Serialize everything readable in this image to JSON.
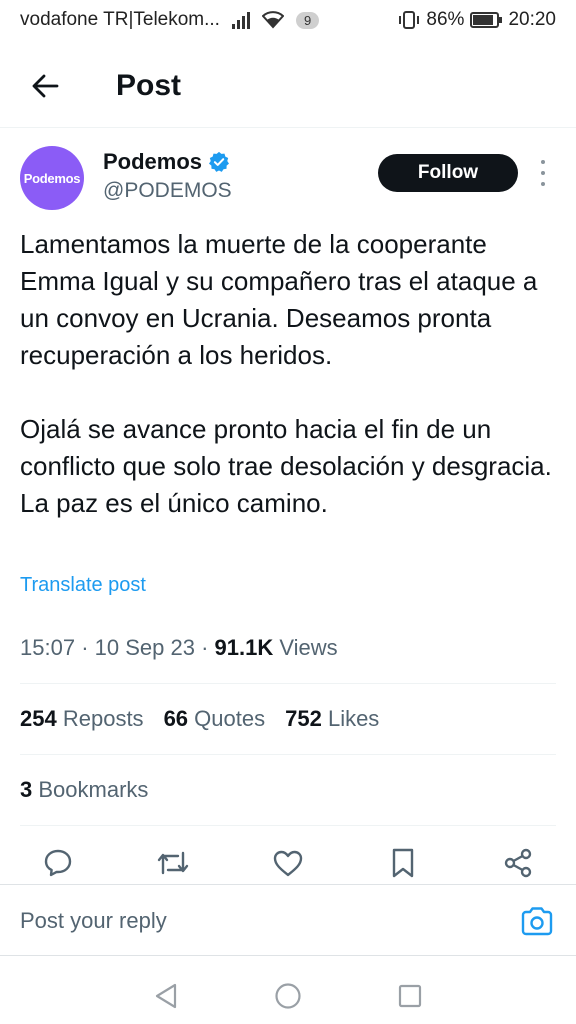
{
  "status_bar": {
    "carrier": "vodafone TR|Telekom...",
    "notification_count": "9",
    "battery": "86%",
    "time": "20:20"
  },
  "header": {
    "title": "Post",
    "back_icon": "arrow-left-icon"
  },
  "author": {
    "avatar_text": "Podemos",
    "name": "Podemos",
    "handle": "@PODEMOS",
    "verified": true,
    "follow_label": "Follow"
  },
  "post": {
    "paragraph_1": "Lamentamos la muerte de la cooperante Emma Igual y su compañero tras el ataque a un convoy en Ucrania. Deseamos pronta recuperación a los heridos.",
    "paragraph_2": "Ojalá se avance pronto hacia el fin de un conflicto que solo trae desolación y desgracia. La paz es el único camino.",
    "translate_label": "Translate post",
    "time": "15:07",
    "date": "10 Sep 23",
    "views_count": "91.1K",
    "views_label": "Views",
    "separator": "·"
  },
  "stats": {
    "reposts_count": "254",
    "reposts_label": "Reposts",
    "quotes_count": "66",
    "quotes_label": "Quotes",
    "likes_count": "752",
    "likes_label": "Likes",
    "bookmarks_count": "3",
    "bookmarks_label": "Bookmarks"
  },
  "actions": [
    "reply-icon",
    "repost-icon",
    "like-icon",
    "bookmark-icon",
    "share-icon"
  ],
  "reply": {
    "placeholder": "Post your reply"
  },
  "colors": {
    "accent": "#1d9bf0",
    "avatar_bg": "#8b5cf6",
    "follow_bg": "#0f1419",
    "text": "#0f1419",
    "secondary": "#536471"
  }
}
